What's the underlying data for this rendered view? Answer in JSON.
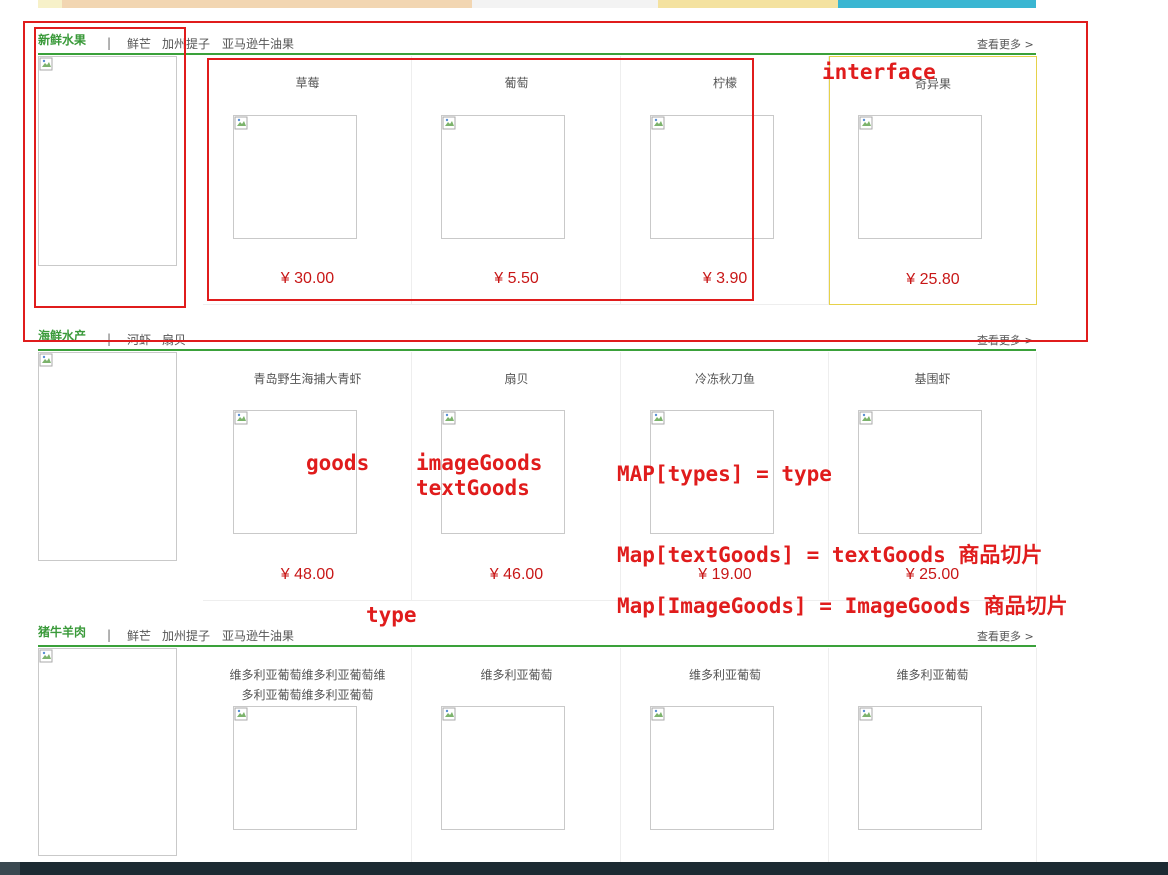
{
  "sections": [
    {
      "title": "新鲜水果",
      "separator": "|",
      "links": [
        "鲜芒",
        "加州提子",
        "亚马逊牛油果"
      ],
      "more": "查看更多 >",
      "goods": [
        {
          "name": "草莓",
          "price": "¥ 30.00"
        },
        {
          "name": "葡萄",
          "price": "¥ 5.50"
        },
        {
          "name": "柠檬",
          "price": "¥ 3.90"
        },
        {
          "name": "奇异果",
          "price": "¥ 25.80"
        }
      ]
    },
    {
      "title": "海鲜水产",
      "separator": "|",
      "links": [
        "河虾",
        "扇贝"
      ],
      "more": "查看更多 >",
      "goods": [
        {
          "name": "青岛野生海捕大青虾",
          "price": "¥ 48.00"
        },
        {
          "name": "扇贝",
          "price": "¥ 46.00"
        },
        {
          "name": "冷冻秋刀鱼",
          "price": "¥ 19.00"
        },
        {
          "name": "基围虾",
          "price": "¥ 25.00"
        }
      ]
    },
    {
      "title": "猪牛羊肉",
      "separator": "|",
      "links": [
        "鲜芒",
        "加州提子",
        "亚马逊牛油果"
      ],
      "more": "查看更多 >",
      "goods": [
        {
          "name_line1": "维多利亚葡萄维多利亚葡萄维",
          "name_line2": "多利亚葡萄维多利亚葡萄"
        },
        {
          "name": "维多利亚葡萄"
        },
        {
          "name": "维多利亚葡萄"
        },
        {
          "name": "维多利亚葡萄"
        }
      ]
    }
  ],
  "annotations": {
    "interface": "interface",
    "goods": "goods",
    "imageGoods": "imageGoods",
    "textGoods": "textGoods",
    "map_types": "MAP[types] = type",
    "map_text": "Map[textGoods] = textGoods  商品切片",
    "map_image": "Map[ImageGoods] = ImageGoods 商品切片",
    "type": "type"
  },
  "colors": {
    "accent_green": "#3aa13a",
    "price_red": "#c81717",
    "annotation_red": "#e01c1c",
    "hover_border": "#e6d24a"
  }
}
